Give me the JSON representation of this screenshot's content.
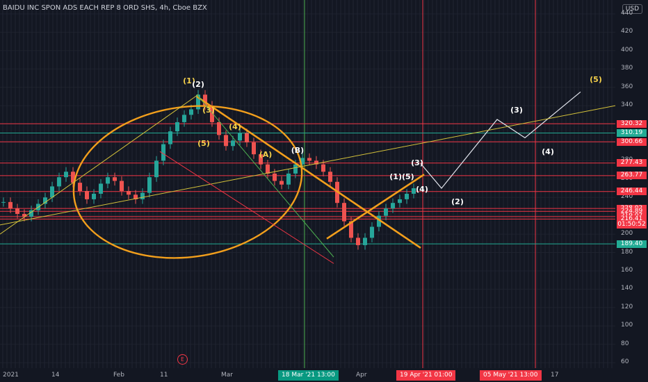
{
  "header": {
    "title": "BAIDU INC SPON ADS EACH REP 8 ORD SHS, 4h, Cboe BZX",
    "currency_button": "USD"
  },
  "chart_data": {
    "type": "line",
    "title": "BAIDU INC SPON ADS EACH REP 8 ORD SHS, 4h, Cboe BZX",
    "y_ticks": [
      60,
      80,
      100,
      120,
      140,
      160,
      180,
      200,
      220,
      240,
      260,
      280,
      300,
      320,
      340,
      360,
      380,
      400,
      420,
      440
    ],
    "ylim": [
      55,
      450
    ],
    "x_ticks": [
      "2021",
      "14",
      "Feb",
      "11",
      "Mar",
      "Apr",
      "17"
    ],
    "time_markers": [
      "18 Mar '21 13:00",
      "19 Apr '21  01:00",
      "05 May '21  13:00"
    ],
    "price_levels": [
      {
        "value": 320.32,
        "color": "#f23645"
      },
      {
        "value": 310.19,
        "color": "#22ab94"
      },
      {
        "value": 300.66,
        "color": "#f23645"
      },
      {
        "value": 277.43,
        "color": "#f23645"
      },
      {
        "value": 263.77,
        "color": "#f23645"
      },
      {
        "value": 246.44,
        "color": "#f23645"
      },
      {
        "value": 228.02,
        "color": "#f23645"
      },
      {
        "value": 224.89,
        "color": "#f23645"
      },
      {
        "value": 219.07,
        "color": "#f23645"
      },
      {
        "value": 216.41,
        "color": "#f23645"
      },
      {
        "value": 189.4,
        "color": "#22ab94"
      }
    ],
    "current_price": {
      "value": "219.07",
      "countdown": "01:50:52"
    },
    "price_series": [
      235,
      228,
      222,
      219,
      226,
      233,
      240,
      252,
      262,
      268,
      256,
      247,
      238,
      244,
      255,
      262,
      258,
      247,
      243,
      238,
      245,
      262,
      280,
      298,
      312,
      322,
      330,
      336,
      352,
      340,
      322,
      308,
      296,
      302,
      310,
      300,
      287,
      276,
      266,
      258,
      254,
      266,
      276,
      283,
      280,
      276,
      268,
      257,
      234,
      214,
      196,
      188,
      196,
      208,
      220,
      228,
      234,
      238,
      244,
      250
    ],
    "projection": [
      {
        "date_idx": 60,
        "price": 277
      },
      {
        "date_idx": 63,
        "price": 250
      },
      {
        "date_idx": 71,
        "price": 325
      },
      {
        "date_idx": 75,
        "price": 305
      },
      {
        "date_idx": 83,
        "price": 355
      }
    ],
    "wave_labels": [
      "(1)",
      "(2)",
      "(3)",
      "(4)",
      "(5)",
      "(A)",
      "(B)",
      "(1)(5)",
      "(3)",
      "(4)",
      "(2)",
      "(3)",
      "(4)",
      "(5)"
    ],
    "legend": [],
    "grid": true
  }
}
